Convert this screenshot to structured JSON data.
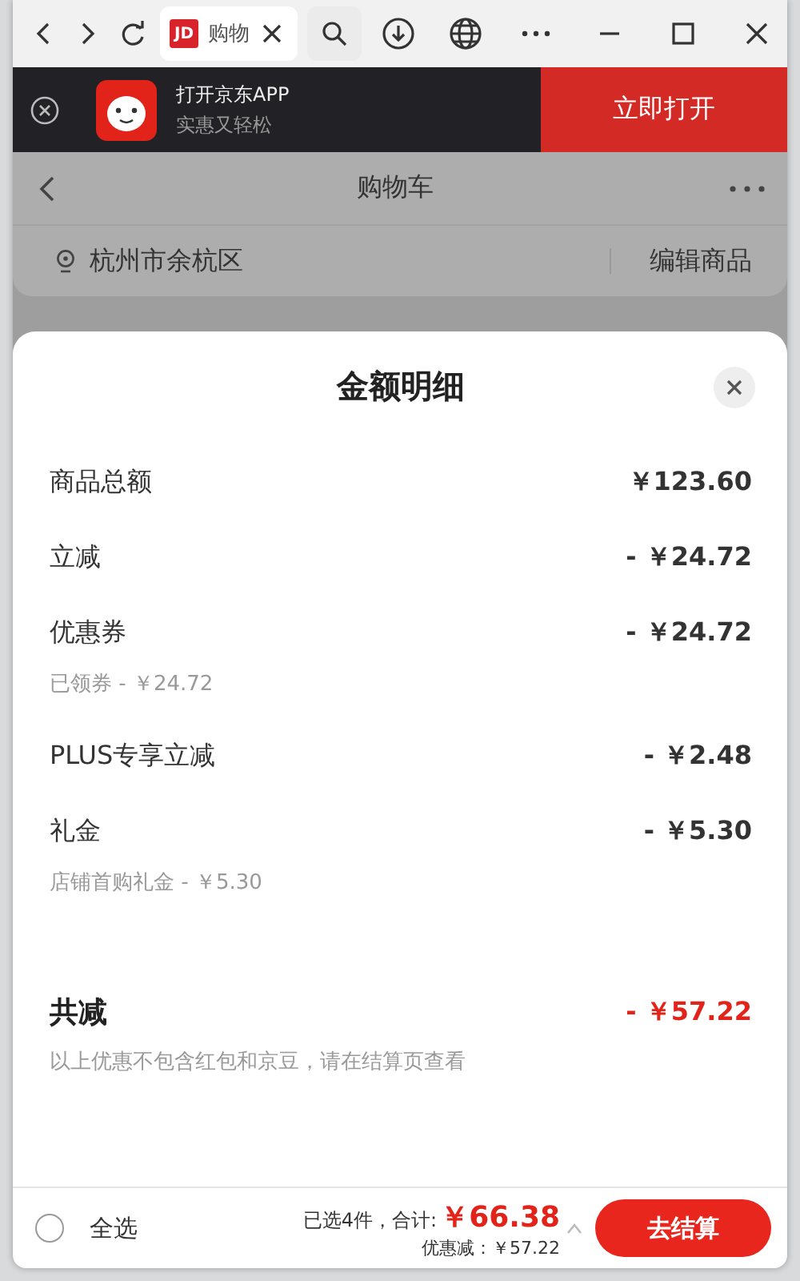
{
  "browser": {
    "favicon_text": "JD",
    "tab_title": "购物"
  },
  "banner": {
    "title": "打开京东APP",
    "subtitle": "实惠又轻松",
    "button": "立即打开"
  },
  "header": {
    "title": "购物车",
    "location": "杭州市余杭区",
    "edit": "编辑商品"
  },
  "sheet": {
    "title": "金额明细",
    "rows": [
      {
        "label": "商品总额",
        "amount": "￥123.60"
      },
      {
        "label": "立减",
        "amount": "- ￥24.72"
      },
      {
        "label": "优惠券",
        "amount": "- ￥24.72",
        "note": "已领券 - ￥24.72"
      },
      {
        "label": "PLUS专享立减",
        "amount": "- ￥2.48"
      },
      {
        "label": "礼金",
        "amount": "- ￥5.30",
        "note": "店铺首购礼金 - ￥5.30"
      }
    ],
    "total": {
      "label": "共减",
      "amount": "- ￥57.22",
      "note": "以上优惠不包含红包和京豆，请在结算页查看"
    }
  },
  "footer": {
    "select_all": {
      "label": "全选",
      "checked": false
    },
    "summary": "已选4件，合计:",
    "total": "￥66.38",
    "discount": "优惠减：￥57.22",
    "checkout": "去结算"
  }
}
